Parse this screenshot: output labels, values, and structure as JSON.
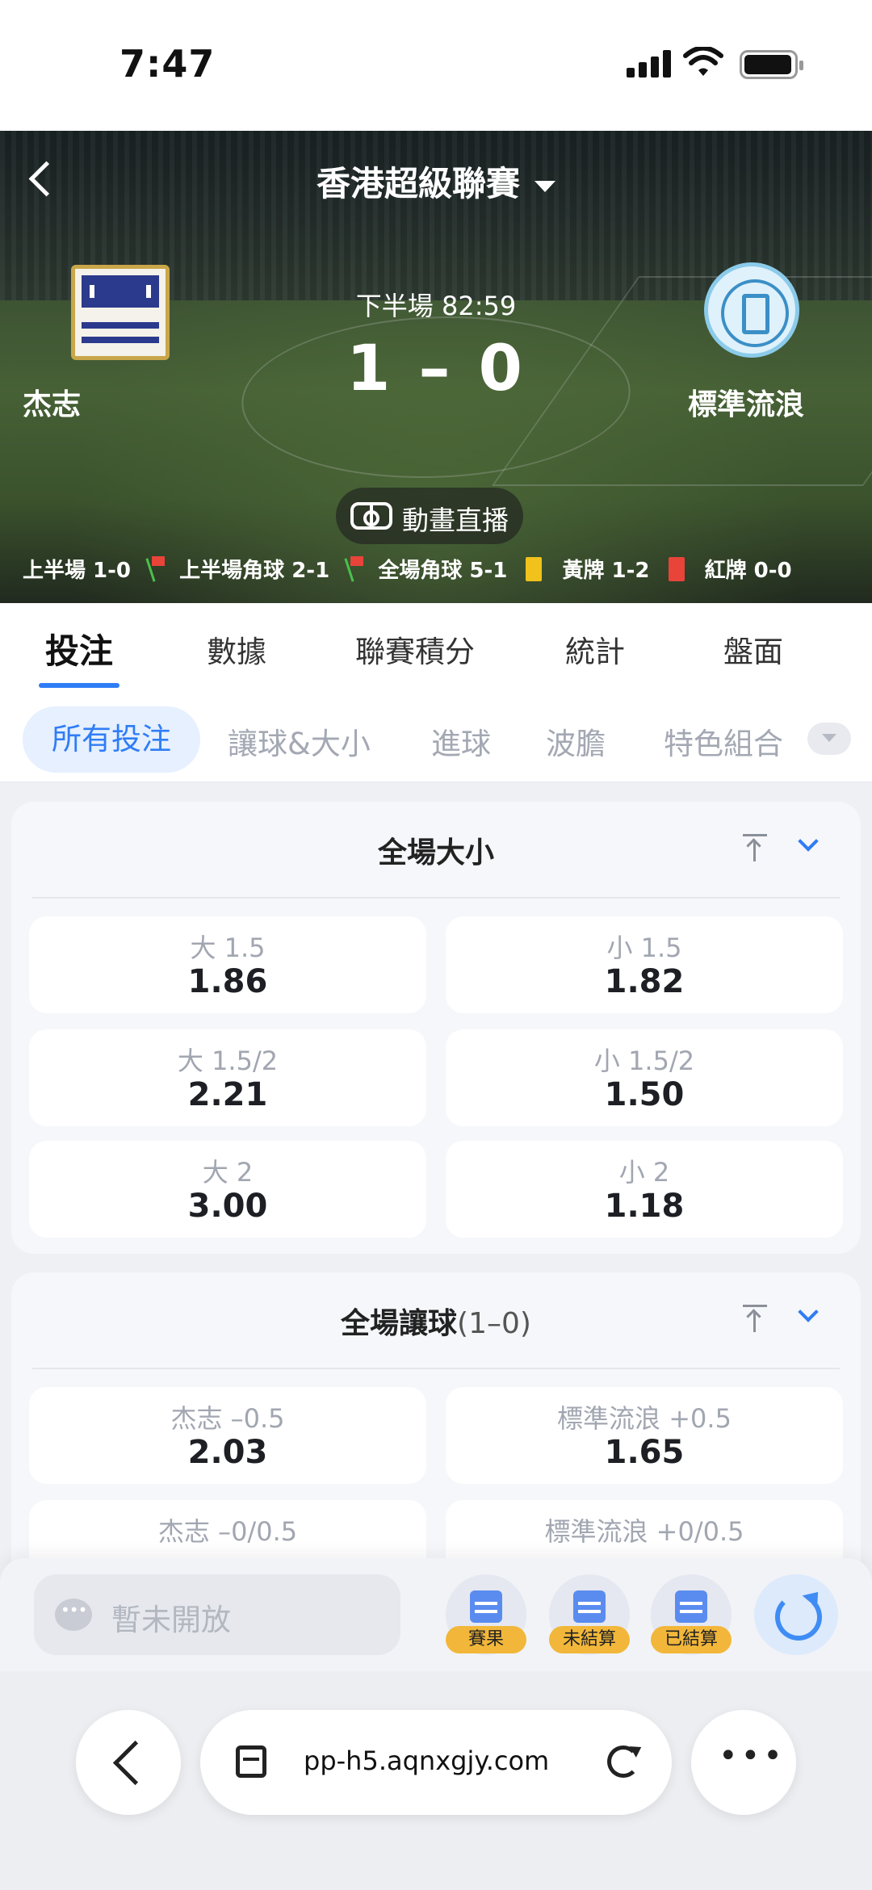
{
  "status": {
    "time": "7:47"
  },
  "header": {
    "league": "香港超級聯賽",
    "period": "下半場 82:59",
    "score": "1 – 0",
    "home": "杰志",
    "away": "標準流浪",
    "live_label": "動畫直播",
    "stats": {
      "first_half": "上半場 1-0",
      "first_half_corners": "上半場角球 2-1",
      "full_corners": "全場角球 5-1",
      "yellow": "黃牌 1-2",
      "red": "紅牌 0-0"
    }
  },
  "main_tabs": [
    "投注",
    "數據",
    "聯賽積分",
    "統計",
    "盤面"
  ],
  "sub_tabs": [
    "所有投注",
    "讓球&大小",
    "進球",
    "波膽",
    "特色組合"
  ],
  "markets": [
    {
      "title": "全場大小",
      "subtitle": "",
      "odds": [
        {
          "label": "大 1.5",
          "value": "1.86"
        },
        {
          "label": "小 1.5",
          "value": "1.82"
        },
        {
          "label": "大 1.5/2",
          "value": "2.21"
        },
        {
          "label": "小 1.5/2",
          "value": "1.50"
        },
        {
          "label": "大 2",
          "value": "3.00"
        },
        {
          "label": "小 2",
          "value": "1.18"
        }
      ]
    },
    {
      "title": "全場讓球",
      "subtitle": "(1–0)",
      "odds": [
        {
          "label": "杰志 –0.5",
          "value": "2.03"
        },
        {
          "label": "標準流浪 +0.5",
          "value": "1.65"
        },
        {
          "label": "杰志 –0/0.5",
          "value": ""
        },
        {
          "label": "標準流浪 +0/0.5",
          "value": ""
        }
      ]
    }
  ],
  "action_bar": {
    "chat_placeholder": "暫未開放",
    "results_label": "賽果",
    "unsettled_label": "未結算",
    "settled_label": "已結算"
  },
  "browser": {
    "url": "pp-h5.aqnxgjy.com"
  },
  "colors": {
    "accent": "#2f7df6",
    "tag": "#f2b73a"
  }
}
